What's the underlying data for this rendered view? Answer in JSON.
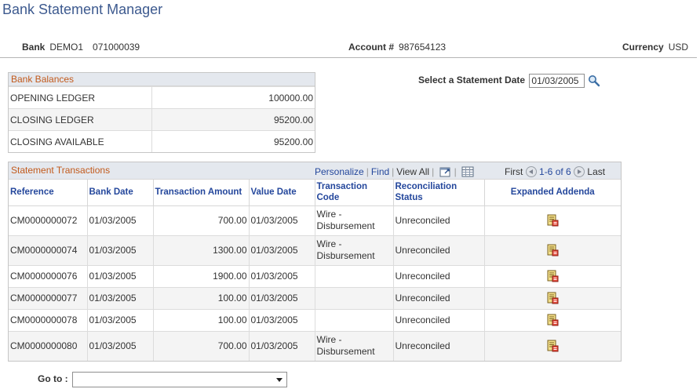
{
  "page": {
    "title": "Bank Statement Manager"
  },
  "info": {
    "bank_label": "Bank",
    "bank_code": "DEMO1",
    "bank_number": "071000039",
    "account_label": "Account #",
    "account_value": "987654123",
    "currency_label": "Currency",
    "currency_value": "USD"
  },
  "balances": {
    "title": "Bank Balances",
    "rows": [
      {
        "label": "OPENING LEDGER",
        "value": "100000.00"
      },
      {
        "label": "CLOSING LEDGER",
        "value": "95200.00"
      },
      {
        "label": "CLOSING AVAILABLE",
        "value": "95200.00"
      }
    ]
  },
  "statement_date": {
    "label": "Select a Statement Date",
    "value": "01/03/2005",
    "icon": "lookup-icon"
  },
  "transactions": {
    "title": "Statement Transactions",
    "tools": {
      "personalize": "Personalize",
      "find": "Find",
      "view_all": "View All"
    },
    "nav": {
      "first": "First",
      "range": "1-6 of 6",
      "last": "Last"
    },
    "columns": {
      "reference": "Reference",
      "bank_date": "Bank Date",
      "amount": "Transaction Amount",
      "value_date": "Value Date",
      "code": "Transaction Code",
      "status": "Reconciliation Status",
      "addenda": "Expanded Addenda"
    },
    "rows": [
      {
        "ref": "CM0000000072",
        "bank_date": "01/03/2005",
        "amount": "700.00",
        "value_date": "01/03/2005",
        "code": "Wire - Disbursement",
        "status": "Unreconciled"
      },
      {
        "ref": "CM0000000074",
        "bank_date": "01/03/2005",
        "amount": "1300.00",
        "value_date": "01/03/2005",
        "code": "Wire - Disbursement",
        "status": "Unreconciled"
      },
      {
        "ref": "CM0000000076",
        "bank_date": "01/03/2005",
        "amount": "1900.00",
        "value_date": "01/03/2005",
        "code": "",
        "status": "Unreconciled"
      },
      {
        "ref": "CM0000000077",
        "bank_date": "01/03/2005",
        "amount": "100.00",
        "value_date": "01/03/2005",
        "code": "",
        "status": "Unreconciled"
      },
      {
        "ref": "CM0000000078",
        "bank_date": "01/03/2005",
        "amount": "100.00",
        "value_date": "01/03/2005",
        "code": "",
        "status": "Unreconciled"
      },
      {
        "ref": "CM0000000080",
        "bank_date": "01/03/2005",
        "amount": "700.00",
        "value_date": "01/03/2005",
        "code": "Wire - Disbursement",
        "status": "Unreconciled"
      }
    ]
  },
  "goto": {
    "label": "Go to :",
    "value": ""
  },
  "colors": {
    "title": "#3d5a8f",
    "link": "#24479c",
    "panel_title": "#c25a1c",
    "panel_head_bg": "#e4e8ee"
  }
}
